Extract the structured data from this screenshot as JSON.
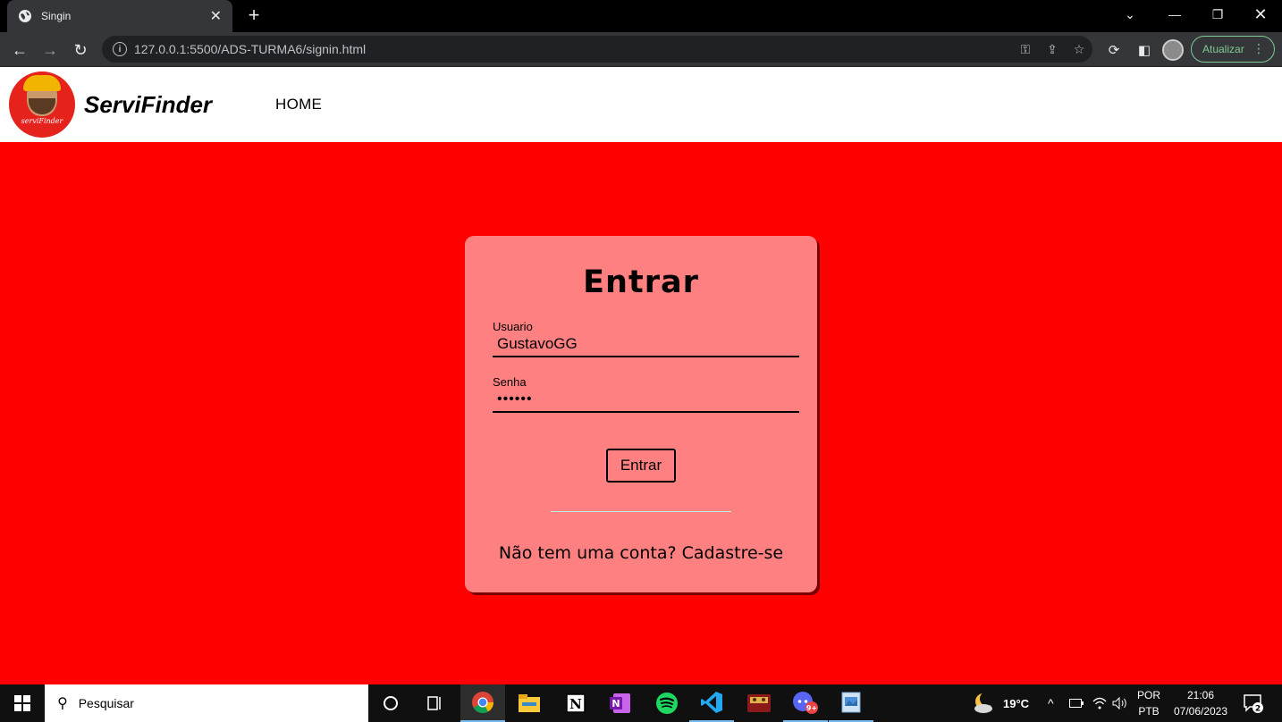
{
  "browser": {
    "tab_title": "Singin",
    "url": "127.0.0.1:5500/ADS-TURMA6/signin.html",
    "update_label": "Atualizar"
  },
  "site": {
    "logo_text": "serviFinder",
    "brand": "ServiFinder",
    "nav_home": "HOME"
  },
  "login": {
    "title": "Entrar",
    "user_label": "Usuario",
    "user_value": "GustavoGG",
    "password_label": "Senha",
    "password_value": "••••••",
    "submit_label": "Entrar",
    "signup_text": "Não tem uma conta? Cadastre-se"
  },
  "taskbar": {
    "search_placeholder": "Pesquisar",
    "temperature": "19°C",
    "lang_1": "POR",
    "lang_2": "PTB",
    "time": "21:06",
    "date": "07/06/2023",
    "notification_count": "2",
    "discord_badge": "9+"
  },
  "colors": {
    "page_background": "#ff0000",
    "card_background": "#ff8080",
    "chrome_dark": "#35363a",
    "update_green": "#81c995"
  }
}
